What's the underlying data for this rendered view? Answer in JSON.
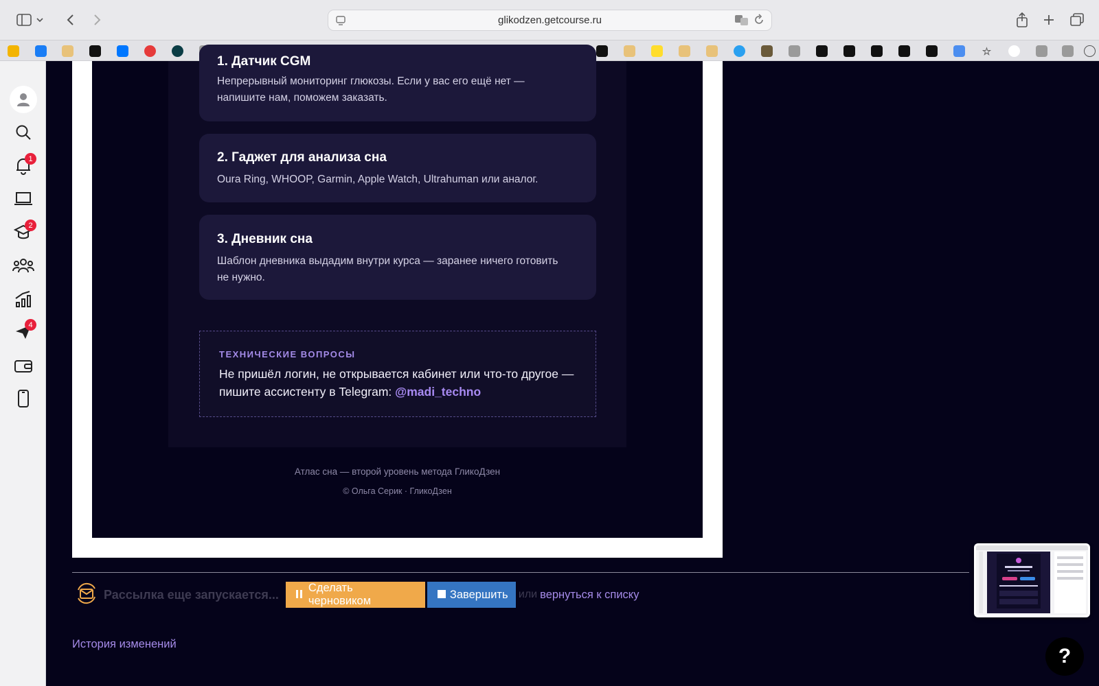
{
  "browser": {
    "url": "glikodzen.getcourse.ru"
  },
  "sidebar": {
    "items": [
      {
        "name": "profile",
        "badge": ""
      },
      {
        "name": "search",
        "badge": ""
      },
      {
        "name": "notifications",
        "badge": "1"
      },
      {
        "name": "laptop",
        "badge": ""
      },
      {
        "name": "courses",
        "badge": "2"
      },
      {
        "name": "users",
        "badge": ""
      },
      {
        "name": "analytics",
        "badge": ""
      },
      {
        "name": "messages",
        "badge": "4"
      },
      {
        "name": "wallet",
        "badge": ""
      },
      {
        "name": "mobile",
        "badge": ""
      }
    ]
  },
  "preview": {
    "card1_title": "1. Датчик CGM",
    "card1_text": "Непрерывный мониторинг глюкозы. Если у вас его ещё нет — напишите нам, поможем заказать.",
    "card2_title": "2. Гаджет для анализа сна",
    "card2_text": "Oura Ring, WHOOP, Garmin, Apple Watch, Ultrahuman или аналог.",
    "card3_title": "3. Дневник сна",
    "card3_text": "Шаблон дневника выдадим внутри курса — заранее ничего готовить не нужно.",
    "tech_label": "ТЕХНИЧЕСКИЕ ВОПРОСЫ",
    "tech_text": "Не пришёл логин, не открывается кабинет или что-то другое — пишите ассистенту в Telegram:",
    "tech_link": "@madi_techno",
    "footer_line1": "Атлас сна — второй уровень метода ГликоДзен",
    "footer_line2": "© Ольга Серик · ГликоДзен"
  },
  "actions": {
    "status_text": "Рассылка еще запускается...",
    "draft_button": "Сделать черновиком",
    "finish_button": "Завершить",
    "or_text": "или",
    "back_link": "вернуться к списку",
    "history_link": "История изменений"
  },
  "help": {
    "label": "?"
  },
  "colors": {
    "page_bg": "#05031a",
    "card_bg": "#1c183a",
    "accent_purple": "#a58be8",
    "draft_orange": "#f0a94a",
    "finish_blue": "#3575c2",
    "badge_red": "#e8203b"
  }
}
